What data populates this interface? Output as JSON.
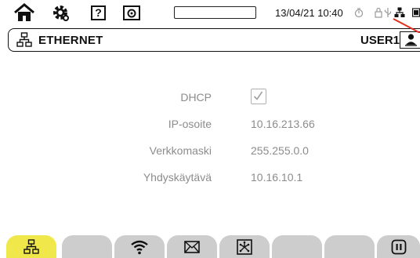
{
  "status_bar": {
    "datetime": "13/04/21 10:40",
    "icons": [
      "home-icon",
      "gear-icon",
      "help-icon",
      "camera-icon",
      "storage-bar",
      "timer-icon",
      "lock-icon",
      "usb-icon",
      "network-icon",
      "battery-icon"
    ]
  },
  "header": {
    "title": "ETHERNET",
    "user": "USER1",
    "icons": [
      "network-icon",
      "user-icon"
    ]
  },
  "form": {
    "dhcp": {
      "label": "DHCP",
      "checked": true
    },
    "ip": {
      "label": "IP-osoite",
      "value": "10.16.213.66"
    },
    "mask": {
      "label": "Verkkomaski",
      "value": "255.255.0.0"
    },
    "gateway": {
      "label": "Yhdyskäytävä",
      "value": "10.16.10.1"
    }
  },
  "tabs": [
    {
      "icon": "network-icon",
      "active": true
    },
    {
      "icon": "",
      "active": false
    },
    {
      "icon": "wifi-icon",
      "active": false
    },
    {
      "icon": "mail-icon",
      "active": false
    },
    {
      "icon": "hub-icon",
      "active": false
    },
    {
      "icon": "",
      "active": false
    },
    {
      "icon": "",
      "active": false
    },
    {
      "icon": "pause-icon",
      "active": false
    }
  ],
  "colors": {
    "active_tab": "#f0e84a",
    "inactive_tab": "#cdcdcd",
    "muted_text": "#8c8c8c",
    "annotation": "#e0301e"
  }
}
